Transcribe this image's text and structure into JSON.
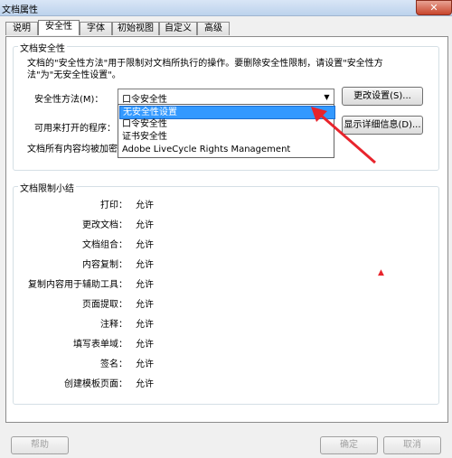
{
  "window": {
    "title": "文档属性",
    "close_glyph": "✕"
  },
  "tabs": [
    {
      "label": "说明"
    },
    {
      "label": "安全性"
    },
    {
      "label": "字体"
    },
    {
      "label": "初始视图"
    },
    {
      "label": "自定义"
    },
    {
      "label": "高级"
    }
  ],
  "security": {
    "group_title": "文档安全性",
    "description": "文档的\"安全性方法\"用于限制对文档所执行的操作。要删除安全性限制，请设置\"安全性方法\"为\"无安全性设置\"。",
    "method_label": "安全性方法(M)：",
    "method_value": "口令安全性",
    "change_settings_button": "更改设置(S)...",
    "open_with_label": "可用来打开的程序：",
    "show_details_button": "显示详细信息(D)...",
    "encrypted_label": "文档所有内容均被加密，",
    "dropdown_options": [
      {
        "label": "无安全性设置"
      },
      {
        "label": "口令安全性"
      },
      {
        "label": "证书安全性"
      },
      {
        "label": "Adobe LiveCycle Rights Management"
      }
    ]
  },
  "summary": {
    "group_title": "文档限制小结",
    "rows": [
      {
        "label": "打印：",
        "value": "允许"
      },
      {
        "label": "更改文档：",
        "value": "允许"
      },
      {
        "label": "文档组合：",
        "value": "允许"
      },
      {
        "label": "内容复制：",
        "value": "允许"
      },
      {
        "label": "复制内容用于辅助工具：",
        "value": "允许"
      },
      {
        "label": "页面提取：",
        "value": "允许"
      },
      {
        "label": "注释：",
        "value": "允许"
      },
      {
        "label": "填写表单域：",
        "value": "允许"
      },
      {
        "label": "签名：",
        "value": "允许"
      },
      {
        "label": "创建模板页面：",
        "value": "允许"
      }
    ]
  },
  "footer": {
    "help_button": "帮助",
    "ok_button": "确定",
    "cancel_button": "取消"
  },
  "colors": {
    "selection": "#3399ff",
    "arrow": "#e8242c"
  },
  "icons": {
    "combo_arrow": "▼",
    "marker": "▲"
  }
}
